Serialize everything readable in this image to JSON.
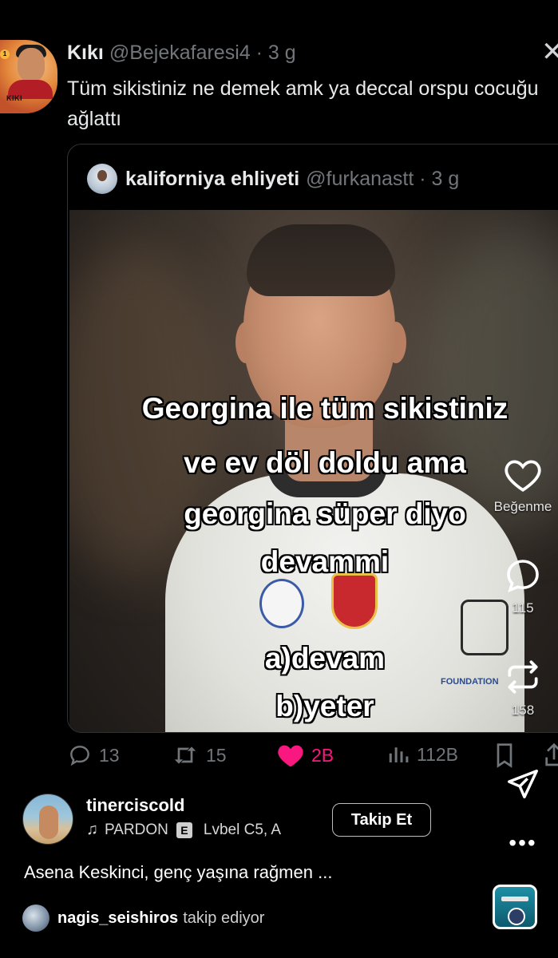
{
  "tweet": {
    "author_name": "Kıkı",
    "author_handle": "@Bejekafaresi4 · 3 g",
    "avatar_tag": "KIKI",
    "avatar_badge": "1",
    "text": "Tüm sikistiniz ne demek amk ya deccal orspu cocuğu ağlattı"
  },
  "quote": {
    "author_name": "kaliforniya ehliyeti",
    "author_handle": "@furkanastt · 3 g",
    "overlay_lines": [
      "Georgina ile tüm sikistiniz",
      "ve ev döl doldu ama",
      "georgina süper diyo",
      "devammi",
      "a)devam",
      "b)yeter"
    ],
    "jersey_text": "FOUNDATION"
  },
  "tweet_actions": {
    "replies": "13",
    "retweets": "15",
    "likes": "2B",
    "views": "112B"
  },
  "reel_rail": {
    "like_label": "Beğenme",
    "comments": "115",
    "reposts": "158"
  },
  "reel": {
    "username": "tinerciscold",
    "music_title": "PARDON",
    "explicit_badge": "E",
    "music_artist": "Lvbel C5, A",
    "follow_label": "Takip Et",
    "caption": "Asena Keskinci, genç yaşına rağmen ...",
    "follower_name": "nagis_seishiros",
    "follower_text": "takip ediyor"
  },
  "colors": {
    "like_pink": "#f91880",
    "muted": "#71767b",
    "text": "#e7e9ea"
  }
}
